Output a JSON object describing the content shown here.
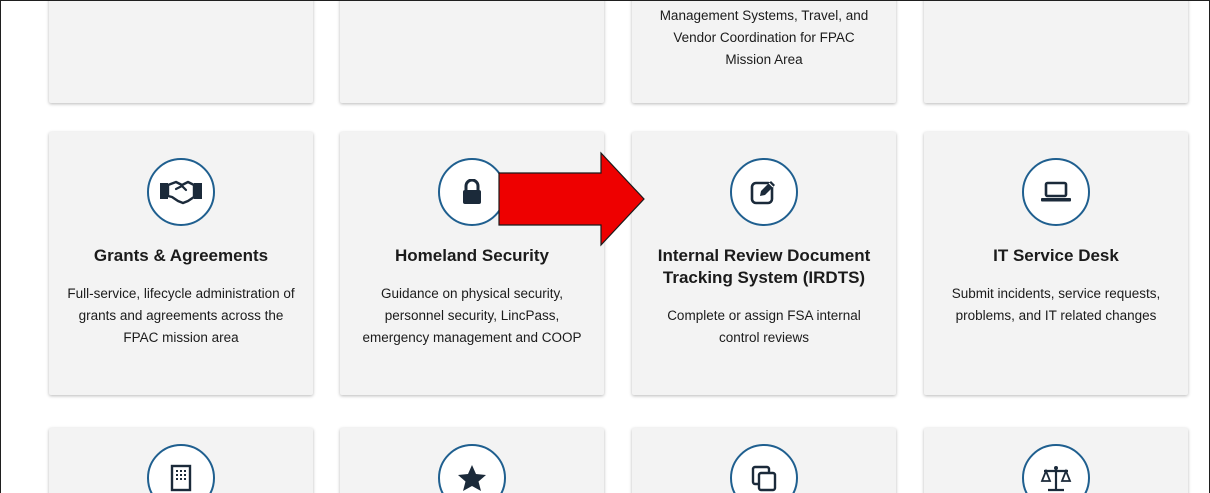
{
  "top_row": {
    "card3_desc": "Management Systems, Travel, and Vendor Coordination for FPAC Mission Area"
  },
  "cards": [
    {
      "title": "Grants & Agreements",
      "desc": "Full-service, lifecycle administration of grants and agreements across the FPAC mission area",
      "icon": "handshake-icon"
    },
    {
      "title": "Homeland Security",
      "desc": "Guidance on physical security, personnel security, LincPass, emergency management and COOP",
      "icon": "lock-icon"
    },
    {
      "title": "Internal Review Document Tracking System (IRDTS)",
      "desc": "Complete or assign FSA internal control reviews",
      "icon": "edit-icon"
    },
    {
      "title": "IT Service Desk",
      "desc": "Submit incidents, service requests, problems, and IT related changes",
      "icon": "laptop-icon"
    }
  ],
  "bottom_row_icons": [
    "building-icon",
    "star-icon",
    "copy-icon",
    "scales-icon"
  ],
  "colors": {
    "accent": "#1f5f8f",
    "card_background": "#f3f3f3",
    "arrow": "#ee0000"
  }
}
